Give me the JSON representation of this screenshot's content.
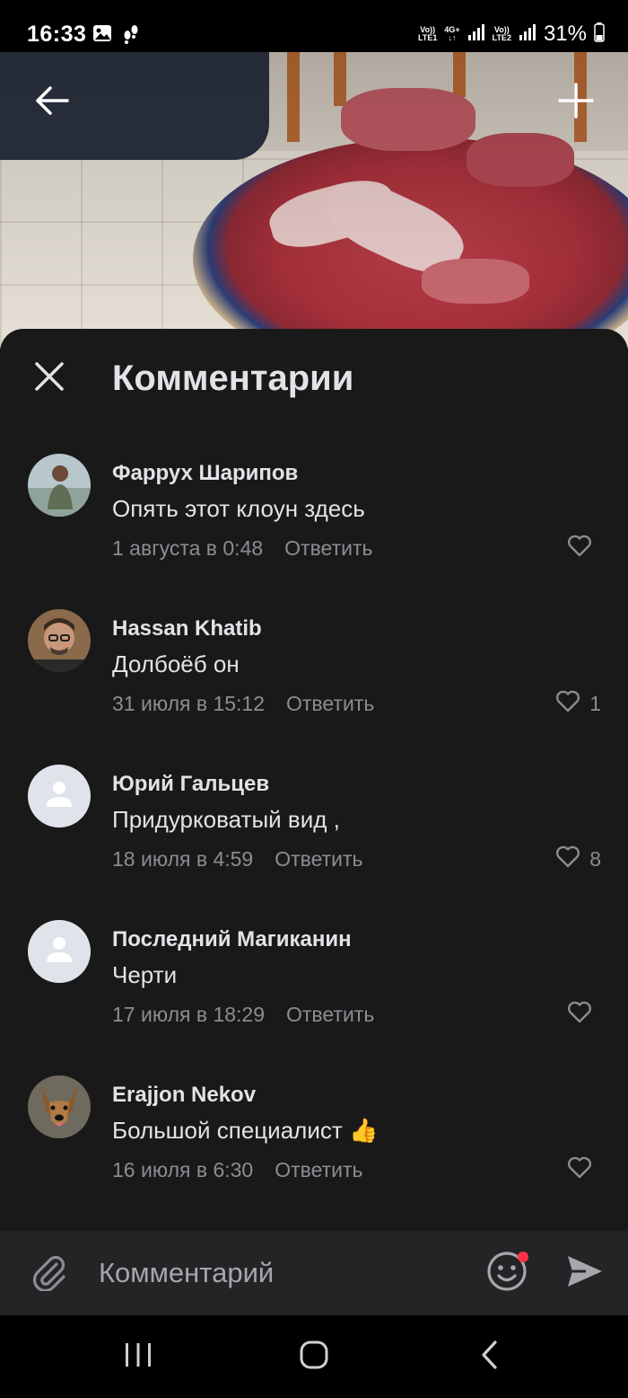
{
  "status_bar": {
    "time": "16:33",
    "sim1_label_top": "Vo))",
    "sim1_label_bottom": "LTE1",
    "network_label": "4G+",
    "sim2_label_top": "Vo))",
    "sim2_label_bottom": "LTE2",
    "battery": "31%",
    "icons": [
      "gallery-icon",
      "footsteps-icon",
      "signal-icon",
      "battery-icon"
    ]
  },
  "video_header": {
    "back_icon": "arrow-left-icon",
    "add_icon": "plus-icon"
  },
  "comments_panel": {
    "title": "Комментарии",
    "close_icon": "close-icon",
    "comments": [
      {
        "author": "Фаррух Шарипов",
        "text": "Опять этот клоун здесь",
        "date": "1 августа в 0:48",
        "reply_label": "Ответить",
        "likes": "",
        "avatar": "photo"
      },
      {
        "author": "Hassan Khatib",
        "text": "Долбоёб он",
        "date": "31 июля в 15:12",
        "reply_label": "Ответить",
        "likes": "1",
        "avatar": "photo"
      },
      {
        "author": "Юрий Гальцев",
        "text": "Придурковатый вид ,",
        "date": "18 июля в 4:59",
        "reply_label": "Ответить",
        "likes": "8",
        "avatar": "placeholder"
      },
      {
        "author": "Последний Магиканин",
        "text": "Черти",
        "date": "17 июля в 18:29",
        "reply_label": "Ответить",
        "likes": "",
        "avatar": "placeholder"
      },
      {
        "author": "Erajjon Nekov",
        "text": "Большой специалист 👍",
        "date": "16 июля в 6:30",
        "reply_label": "Ответить",
        "likes": "",
        "avatar": "photo"
      }
    ]
  },
  "input_bar": {
    "placeholder": "Комментарий",
    "attach_icon": "paperclip-icon",
    "emoji_icon": "smile-icon",
    "send_icon": "send-icon"
  },
  "nav_bar": {
    "buttons": [
      "recent-apps-icon",
      "home-icon",
      "back-icon"
    ]
  },
  "colors": {
    "panel_bg": "#19191a",
    "text_primary": "#e1e3e6",
    "text_secondary": "#8a8d92",
    "input_bg": "#242426",
    "notification_dot": "#ff3347"
  }
}
